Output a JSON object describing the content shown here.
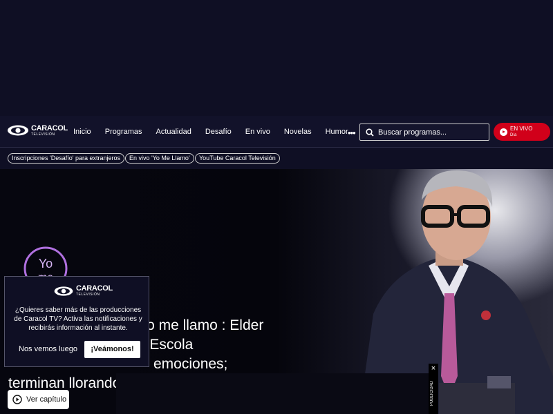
{
  "brand": {
    "name": "CARACOL",
    "subtitle": "TELEVISIÓN"
  },
  "nav": {
    "items": [
      "Inicio",
      "Programas",
      "Actualidad",
      "Desafío",
      "En vivo",
      "Novelas",
      "Humor"
    ],
    "more_icon": "more-dots-icon"
  },
  "search": {
    "placeholder": "Buscar programas...",
    "icon": "search-icon"
  },
  "live": {
    "label": "EN VIVO",
    "sub": "Día",
    "color": "#d1001a"
  },
  "chips": [
    "Inscripciones 'Desafío' para extranjeros",
    "En vivo 'Yo Me Llamo'",
    "YouTube Caracol Televisión"
  ],
  "hero": {
    "logo": "yo me llamo",
    "title": "Corazón nuevo Yo me llamo : Elder y Escola sobre las lla... sus emociones; terminan llorando",
    "title_visible_line1": "Yo me llamo : Elder y Escola",
    "title_visible_line2": "emociones;",
    "title_visible_line3": "terminan llorando",
    "watch_button": "Ver capítulo"
  },
  "notification": {
    "brand": "CARACOL",
    "brand_sub": "TELEVISIÓN",
    "message": "¿Quieres saber más de las producciones de Caracol TV? Activa las notificaciones y recibirás información al instante.",
    "decline": "Nos vemos luego",
    "accept": "¡Veámonos!"
  },
  "ad": {
    "label": "PUBLICIDAD",
    "close": "×"
  },
  "colors": {
    "background": "#0f0f24",
    "accent": "#d1001a"
  }
}
